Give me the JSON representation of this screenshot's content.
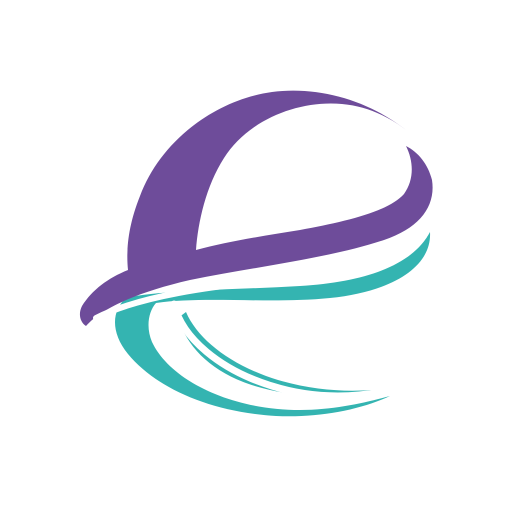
{
  "logo": {
    "icon": "stylized-letter-e-logo",
    "colors": {
      "purple": "#6E4C9A",
      "teal": "#34B4B1",
      "background": "#FFFFFF"
    }
  }
}
